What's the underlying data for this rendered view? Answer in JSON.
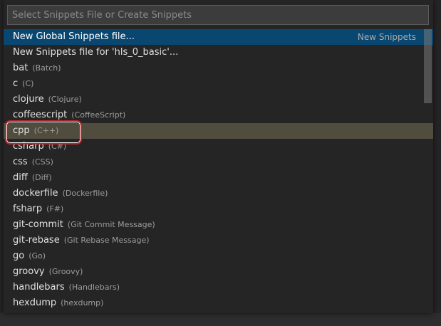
{
  "quick_pick": {
    "placeholder": "Select Snippets File or Create Snippets",
    "value": ""
  },
  "items": [
    {
      "name": "New Global Snippets file...",
      "desc": "",
      "right_label": "New Snippets",
      "state": "active"
    },
    {
      "name": "New Snippets file for 'hls_0_basic'...",
      "desc": "",
      "right_label": "",
      "state": ""
    },
    {
      "name": "bat",
      "desc": "(Batch)",
      "right_label": "",
      "state": ""
    },
    {
      "name": "c",
      "desc": "(C)",
      "right_label": "",
      "state": ""
    },
    {
      "name": "clojure",
      "desc": "(Clojure)",
      "right_label": "",
      "state": ""
    },
    {
      "name": "coffeescript",
      "desc": "(CoffeeScript)",
      "right_label": "",
      "state": ""
    },
    {
      "name": "cpp",
      "desc": "(C++)",
      "right_label": "",
      "state": "hover"
    },
    {
      "name": "csharp",
      "desc": "(C#)",
      "right_label": "",
      "state": ""
    },
    {
      "name": "css",
      "desc": "(CSS)",
      "right_label": "",
      "state": ""
    },
    {
      "name": "diff",
      "desc": "(Diff)",
      "right_label": "",
      "state": ""
    },
    {
      "name": "dockerfile",
      "desc": "(Dockerfile)",
      "right_label": "",
      "state": ""
    },
    {
      "name": "fsharp",
      "desc": "(F#)",
      "right_label": "",
      "state": ""
    },
    {
      "name": "git-commit",
      "desc": "(Git Commit Message)",
      "right_label": "",
      "state": ""
    },
    {
      "name": "git-rebase",
      "desc": "(Git Rebase Message)",
      "right_label": "",
      "state": ""
    },
    {
      "name": "go",
      "desc": "(Go)",
      "right_label": "",
      "state": ""
    },
    {
      "name": "groovy",
      "desc": "(Groovy)",
      "right_label": "",
      "state": ""
    },
    {
      "name": "handlebars",
      "desc": "(Handlebars)",
      "right_label": "",
      "state": ""
    },
    {
      "name": "hexdump",
      "desc": "(hexdump)",
      "right_label": "",
      "state": ""
    }
  ],
  "colors": {
    "active_row": "#094771",
    "hover_row": "#504c3e",
    "highlight_ring": "#c2262b"
  }
}
